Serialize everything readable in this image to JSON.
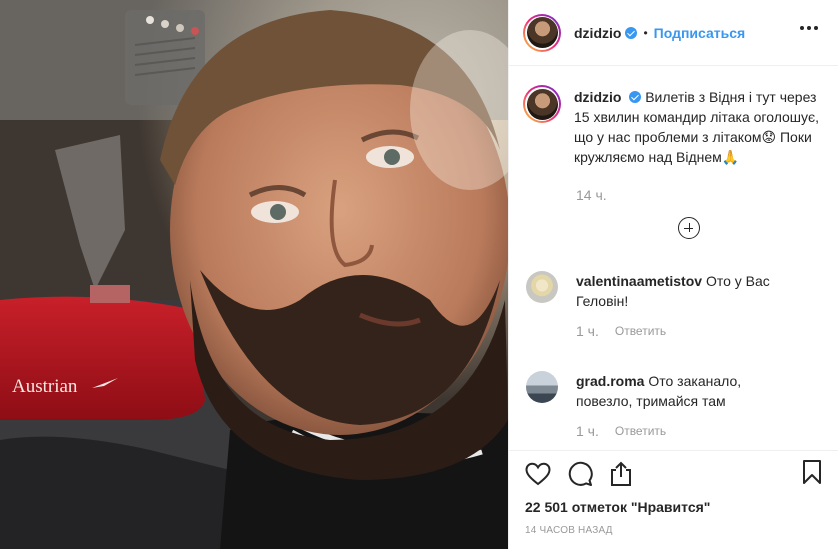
{
  "photo": {
    "seat_brand": "Austrian"
  },
  "header": {
    "username": "dzidzio",
    "separator": "•",
    "follow_label": "Подписаться"
  },
  "caption": {
    "username": "dzidzio",
    "text": "Вилетів з Відня і тут через 15 хвилин командир літака оголошує, що у нас проблеми з літаком😟 Поки кружляємо над Віднем🙏",
    "time": "14 ч."
  },
  "comments": [
    {
      "username": "valentinaametistov",
      "text": "Ото у Вас Геловін!",
      "time": "1 ч.",
      "reply_label": "Ответить"
    },
    {
      "username": "grad.roma",
      "text": "Ото заканало, повезло, тримайся там",
      "time": "1 ч.",
      "reply_label": "Ответить"
    }
  ],
  "actions": {
    "icons": [
      "heart-icon",
      "comment-icon",
      "share-icon",
      "bookmark-icon"
    ],
    "likes": "22 501 отметок \"Нравится\"",
    "posted_ago": "14 ЧАСОВ НАЗАД"
  },
  "colors": {
    "link": "#3897f0",
    "text": "#262626",
    "muted": "#999999",
    "seat_red": "#b3121c"
  }
}
